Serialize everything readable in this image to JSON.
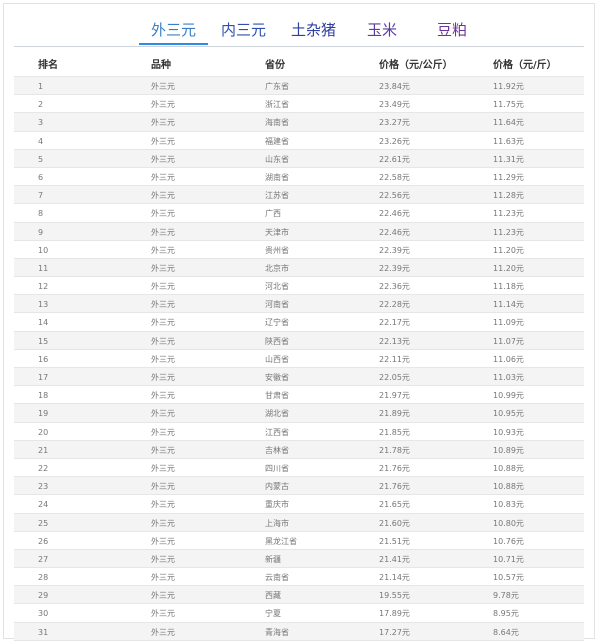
{
  "tabs": [
    {
      "label": "外三元",
      "active": true
    },
    {
      "label": "内三元",
      "active": false
    },
    {
      "label": "土杂猪",
      "active": false
    },
    {
      "label": "玉米",
      "active": false
    },
    {
      "label": "豆粕",
      "active": false
    }
  ],
  "table": {
    "headers": [
      "排名",
      "品种",
      "省份",
      "价格（元/公斤）",
      "价格（元/斤）"
    ],
    "rows": [
      [
        "1",
        "外三元",
        "广东省",
        "23.84元",
        "11.92元"
      ],
      [
        "2",
        "外三元",
        "浙江省",
        "23.49元",
        "11.75元"
      ],
      [
        "3",
        "外三元",
        "海南省",
        "23.27元",
        "11.64元"
      ],
      [
        "4",
        "外三元",
        "福建省",
        "23.26元",
        "11.63元"
      ],
      [
        "5",
        "外三元",
        "山东省",
        "22.61元",
        "11.31元"
      ],
      [
        "6",
        "外三元",
        "湖南省",
        "22.58元",
        "11.29元"
      ],
      [
        "7",
        "外三元",
        "江苏省",
        "22.56元",
        "11.28元"
      ],
      [
        "8",
        "外三元",
        "广西",
        "22.46元",
        "11.23元"
      ],
      [
        "9",
        "外三元",
        "天津市",
        "22.46元",
        "11.23元"
      ],
      [
        "10",
        "外三元",
        "贵州省",
        "22.39元",
        "11.20元"
      ],
      [
        "11",
        "外三元",
        "北京市",
        "22.39元",
        "11.20元"
      ],
      [
        "12",
        "外三元",
        "河北省",
        "22.36元",
        "11.18元"
      ],
      [
        "13",
        "外三元",
        "河南省",
        "22.28元",
        "11.14元"
      ],
      [
        "14",
        "外三元",
        "辽宁省",
        "22.17元",
        "11.09元"
      ],
      [
        "15",
        "外三元",
        "陕西省",
        "22.13元",
        "11.07元"
      ],
      [
        "16",
        "外三元",
        "山西省",
        "22.11元",
        "11.06元"
      ],
      [
        "17",
        "外三元",
        "安徽省",
        "22.05元",
        "11.03元"
      ],
      [
        "18",
        "外三元",
        "甘肃省",
        "21.97元",
        "10.99元"
      ],
      [
        "19",
        "外三元",
        "湖北省",
        "21.89元",
        "10.95元"
      ],
      [
        "20",
        "外三元",
        "江西省",
        "21.85元",
        "10.93元"
      ],
      [
        "21",
        "外三元",
        "吉林省",
        "21.78元",
        "10.89元"
      ],
      [
        "22",
        "外三元",
        "四川省",
        "21.76元",
        "10.88元"
      ],
      [
        "23",
        "外三元",
        "内蒙古",
        "21.76元",
        "10.88元"
      ],
      [
        "24",
        "外三元",
        "重庆市",
        "21.65元",
        "10.83元"
      ],
      [
        "25",
        "外三元",
        "上海市",
        "21.60元",
        "10.80元"
      ],
      [
        "26",
        "外三元",
        "黑龙江省",
        "21.51元",
        "10.76元"
      ],
      [
        "27",
        "外三元",
        "新疆",
        "21.41元",
        "10.71元"
      ],
      [
        "28",
        "外三元",
        "云南省",
        "21.14元",
        "10.57元"
      ],
      [
        "29",
        "外三元",
        "西藏",
        "19.55元",
        "9.78元"
      ],
      [
        "30",
        "外三元",
        "宁夏",
        "17.89元",
        "8.95元"
      ],
      [
        "31",
        "外三元",
        "青海省",
        "17.27元",
        "8.64元"
      ]
    ]
  }
}
